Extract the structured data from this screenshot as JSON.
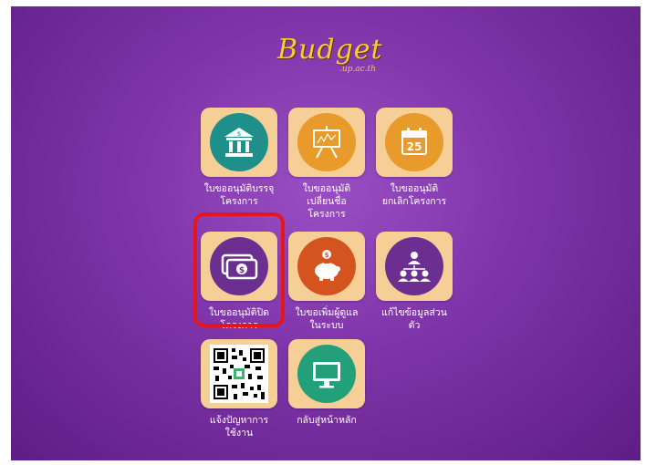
{
  "logo": {
    "main": "Budget",
    "sub": ".up.ac.th"
  },
  "tiles": [
    {
      "label": "ใบขออนุมัติบรรจุ\nโครงการ",
      "icon": "bank-icon"
    },
    {
      "label": "ใบขออนุมัติ\nเปลี่ยนชื่อ\nโครงการ",
      "icon": "presentation-board-icon"
    },
    {
      "label": "ใบขออนุมัติ\nยกเลิกโครงการ",
      "icon": "calendar-icon",
      "calendar_day": "25"
    },
    {
      "label": "ใบขออนุมัติปิด\nโครงการ",
      "icon": "money-icon",
      "highlighted": true
    },
    {
      "label": "ใบขอเพิ่มผู้ดูแล\nในระบบ",
      "icon": "piggy-bank-icon"
    },
    {
      "label": "แก้ไขข้อมูลส่วน\nตัว",
      "icon": "users-network-icon"
    },
    {
      "label": "แจ้งปัญหาการ\nใช้งาน",
      "icon": "qr-code-icon"
    },
    {
      "label": "กลับสู่หน้าหลัก",
      "icon": "monitor-icon"
    }
  ],
  "colors": {
    "background": "#7e34a8",
    "tile_bg": "#f5cf95",
    "logo": "#f3d02b",
    "highlight": "#e8141b",
    "teal": "#1f8f8c",
    "orange": "#e89a2b",
    "purple": "#6b2f92",
    "red_orange": "#d4531e",
    "green": "#23a07a"
  }
}
